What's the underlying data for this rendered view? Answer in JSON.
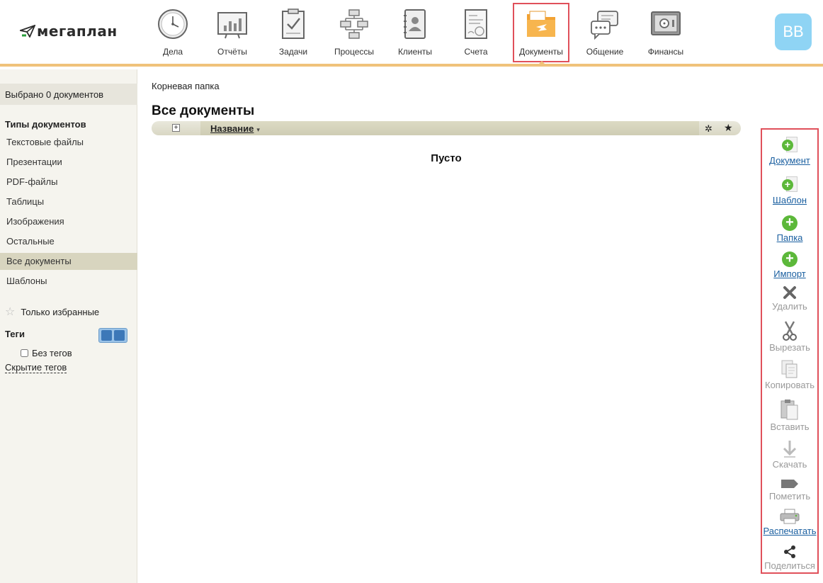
{
  "header": {
    "logo_text": "мегаплан",
    "nav": [
      {
        "label": "Дела",
        "icon": "clock-icon"
      },
      {
        "label": "Отчёты",
        "icon": "report-chart-icon"
      },
      {
        "label": "Задачи",
        "icon": "task-clipboard-icon"
      },
      {
        "label": "Процессы",
        "icon": "process-flow-icon"
      },
      {
        "label": "Клиенты",
        "icon": "contacts-book-icon"
      },
      {
        "label": "Счета",
        "icon": "invoice-icon"
      },
      {
        "label": "Документы",
        "icon": "documents-folder-icon",
        "active": true
      },
      {
        "label": "Общение",
        "icon": "chat-bubbles-icon"
      },
      {
        "label": "Финансы",
        "icon": "safe-icon"
      }
    ],
    "avatar_initials": "BB"
  },
  "sidebar": {
    "selected_count": "Выбрано 0 документов",
    "types_heading": "Типы документов",
    "types": [
      {
        "label": "Текстовые файлы"
      },
      {
        "label": "Презентации"
      },
      {
        "label": "PDF-файлы"
      },
      {
        "label": "Таблицы"
      },
      {
        "label": "Изображения"
      },
      {
        "label": "Остальные"
      },
      {
        "label": "Все документы",
        "active": true
      },
      {
        "label": "Шаблоны"
      }
    ],
    "favorites_only": "Только избранные",
    "tags_heading": "Теги",
    "no_tags": "Без тегов",
    "hide_tags": "Скрытие тегов"
  },
  "main": {
    "breadcrumb": "Корневая папка",
    "title": "Все документы",
    "column_name": "Название",
    "empty_text": "Пусто"
  },
  "actions": [
    {
      "label": "Документ",
      "enabled": true,
      "icon": "add-document-icon"
    },
    {
      "label": "Шаблон",
      "enabled": true,
      "icon": "add-template-icon"
    },
    {
      "label": "Папка",
      "enabled": true,
      "icon": "add-folder-icon"
    },
    {
      "label": "Импорт",
      "enabled": true,
      "icon": "import-icon"
    },
    {
      "label": "Удалить",
      "enabled": false,
      "icon": "delete-x-icon"
    },
    {
      "label": "Вырезать",
      "enabled": false,
      "icon": "scissors-icon"
    },
    {
      "label": "Копировать",
      "enabled": false,
      "icon": "copy-icon"
    },
    {
      "label": "Вставить",
      "enabled": false,
      "icon": "paste-icon"
    },
    {
      "label": "Скачать",
      "enabled": false,
      "icon": "download-arrow-icon"
    },
    {
      "label": "Пометить",
      "enabled": false,
      "icon": "tag-label-icon"
    },
    {
      "label": "Распечатать",
      "enabled": true,
      "icon": "printer-icon"
    },
    {
      "label": "Поделиться",
      "enabled": false,
      "icon": "share-icon"
    }
  ],
  "colors": {
    "accent_orange": "#f0c27a",
    "highlight_red": "#e0505a",
    "add_green": "#5cb83a",
    "link_blue": "#1a5fa0",
    "avatar_blue": "#8fd4f4"
  }
}
